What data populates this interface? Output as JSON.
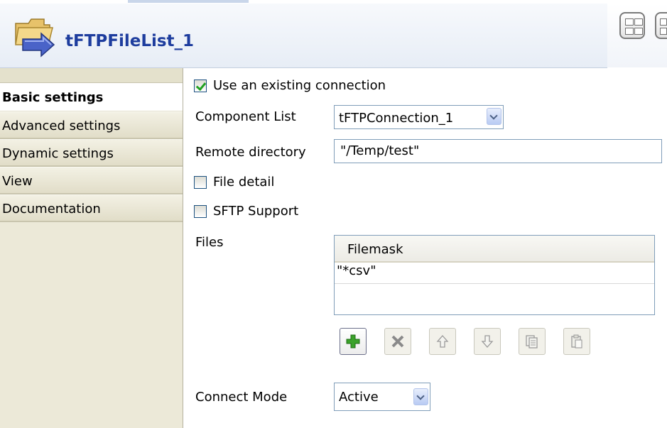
{
  "header": {
    "title": "tFTPFileList_1"
  },
  "sidebar": {
    "tabs": [
      {
        "label": "Basic settings",
        "active": true
      },
      {
        "label": "Advanced settings"
      },
      {
        "label": "Dynamic settings"
      },
      {
        "label": "View"
      },
      {
        "label": "Documentation"
      }
    ]
  },
  "form": {
    "use_existing_connection": {
      "label": "Use an existing connection",
      "checked": true
    },
    "component_list": {
      "label": "Component List",
      "value": "tFTPConnection_1"
    },
    "remote_directory": {
      "label": "Remote directory",
      "value": "\"/Temp/test\""
    },
    "file_detail": {
      "label": "File detail",
      "checked": false
    },
    "sftp_support": {
      "label": "SFTP Support",
      "checked": false
    },
    "files": {
      "label": "Files",
      "column": "Filemask",
      "rows": [
        "\"*csv\""
      ]
    },
    "toolbar_icons": [
      "add-icon",
      "delete-icon",
      "move-up-icon",
      "move-down-icon",
      "copy-icon",
      "paste-icon"
    ],
    "connect_mode": {
      "label": "Connect Mode",
      "value": "Active"
    }
  },
  "colors": {
    "title": "#1e3d9e",
    "sidebar_bg": "#ece9d8",
    "checkmark": "#21a121",
    "add_icon": "#3aa22a"
  }
}
